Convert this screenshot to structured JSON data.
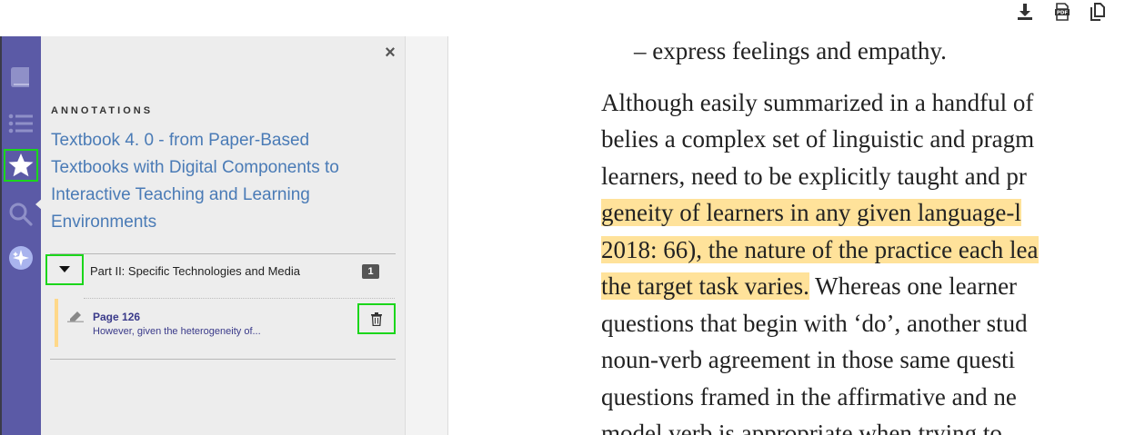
{
  "toolbar": {
    "download": {
      "icon": "download-icon"
    },
    "pdf": {
      "icon": "pdf-icon"
    },
    "copy": {
      "icon": "copy-icon"
    }
  },
  "rail": {
    "items": [
      {
        "name": "book",
        "icon": "book-icon"
      },
      {
        "name": "contents",
        "icon": "list-icon"
      },
      {
        "name": "annotations",
        "icon": "star-icon",
        "active": true
      },
      {
        "name": "search",
        "icon": "search-icon"
      },
      {
        "name": "assistant",
        "icon": "sparkle-icon"
      }
    ]
  },
  "panel": {
    "close_label": "×",
    "heading": "ANNOTATIONS",
    "book_title": "Textbook 4. 0 - from Paper-Based Textbooks with Digital Components to Interactive Teaching and Learning Environments",
    "chapter": {
      "title": "Part II: Specific Technologies and Media",
      "count": "1",
      "expanded": true
    },
    "annotation": {
      "page": "Page 126",
      "excerpt": "However, given the heterogeneity of...",
      "highlight_color": "#ffd88a"
    }
  },
  "reader": {
    "highlight_color": "#ffe29a",
    "bullet": "–   express feelings and empathy.",
    "lines": [
      {
        "plain": "Although easily summarized in a handful of"
      },
      {
        "plain": "belies a complex set of linguistic and pragm"
      },
      {
        "plain": "learners, need to be explicitly taught and pr"
      },
      {
        "hl": "geneity of learners in any given language-l"
      },
      {
        "hl": "2018: 66), the nature of the practice each lea"
      },
      {
        "hl": "the target task varies.",
        "rest": " Whereas one learner"
      },
      {
        "plain": "questions that begin with ‘do’, another stud"
      },
      {
        "plain": "noun-verb agreement in those same questi"
      },
      {
        "plain": "questions framed in the affirmative and ne"
      },
      {
        "plain": "model verb is appropriate when trying to"
      }
    ]
  }
}
